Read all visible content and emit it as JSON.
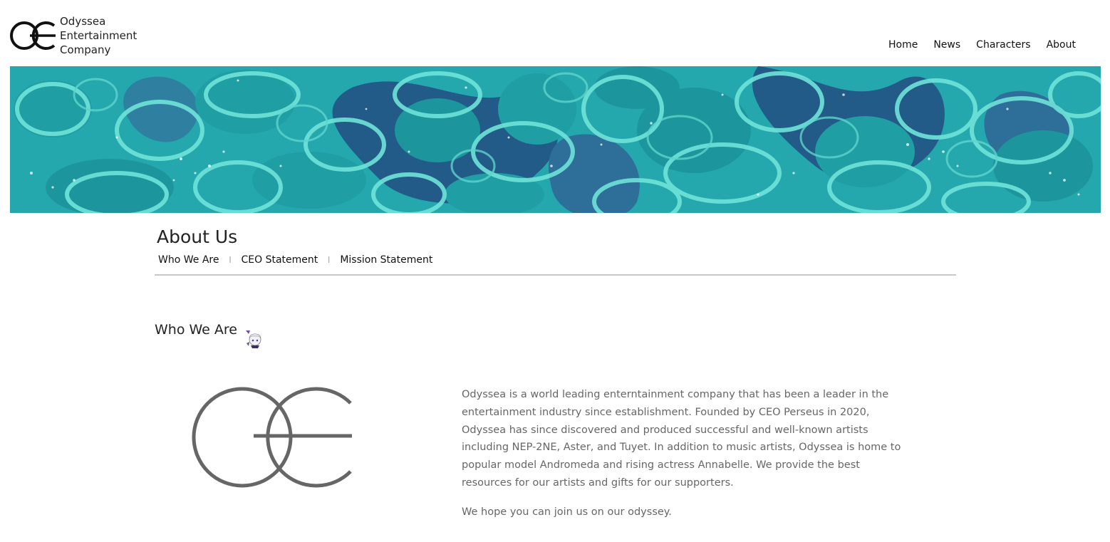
{
  "header": {
    "company_line1": "Odyssea",
    "company_line2": "Entertainment",
    "company_line3": "Company",
    "logo_icon": "oe-logo-icon"
  },
  "nav": {
    "items": [
      "Home",
      "News",
      "Characters",
      "About"
    ]
  },
  "banner": {
    "pattern": "teal-pebble-banner",
    "colors": {
      "base": "#24a8ad",
      "light": "#6fe3d9",
      "dark": "#225b87"
    }
  },
  "about": {
    "title": "About Us",
    "subnav": [
      "Who We Are",
      "CEO Statement",
      "Mission Statement"
    ],
    "separator": "|"
  },
  "who_we_are": {
    "title": "Who We Are",
    "mascot_icon": "chibi-mascot-icon",
    "logo_icon": "oe-large-logo-icon",
    "paragraph1": "Odyssea is a world leading enterntainment company that has been a leader in the entertainment industry since establishment. Founded by CEO Perseus in 2020, Odyssea has since discovered and produced successful and well-known artists including NEP-2NE, Aster, and Tuyet. In addition to music artists, Odyssea is home to popular model Andromeda and rising actress Annabelle. We provide the best resources for our artists and gifts for our supporters.",
    "paragraph2": "We hope you can join us on our odyssey."
  }
}
